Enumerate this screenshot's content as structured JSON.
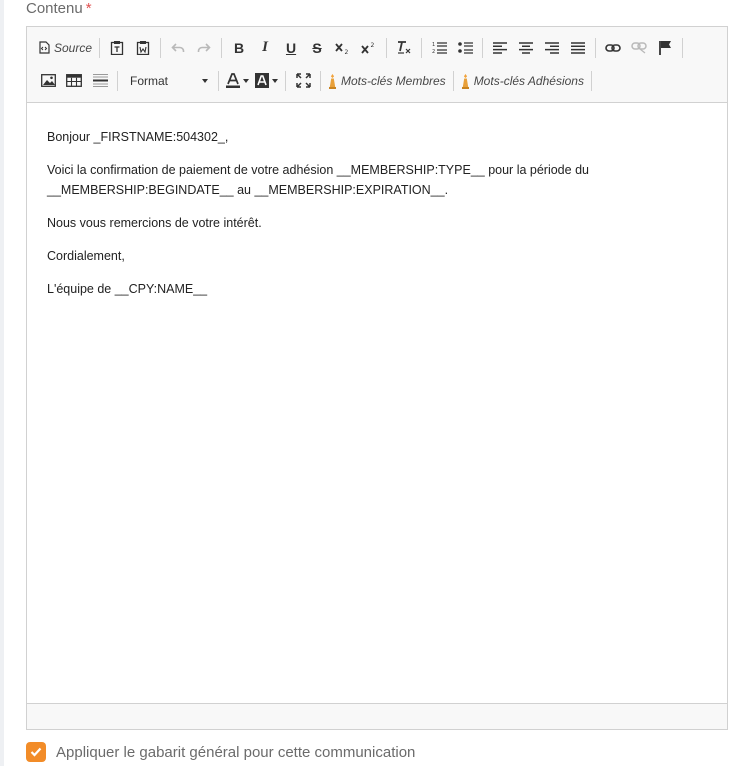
{
  "field": {
    "label": "Contenu",
    "required_mark": "*"
  },
  "toolbar": {
    "source_label": "Source",
    "format_label": "Format",
    "keywords_members_label": "Mots-clés Membres",
    "keywords_memberships_label": "Mots-clés Adhésions"
  },
  "content": {
    "paragraphs": [
      "Bonjour _FIRSTNAME:504302_,",
      "Voici la confirmation de paiement de votre adhésion __MEMBERSHIP:TYPE__ pour la période du __MEMBERSHIP:BEGINDATE__ au __MEMBERSHIP:EXPIRATION__.",
      "Nous vous remercions de votre intérêt.",
      "Cordialement,",
      "L'équipe de __CPY:NAME__"
    ]
  },
  "options": {
    "apply_template_label": "Appliquer le gabarit général pour cette communication",
    "apply_template_checked": true
  },
  "colors": {
    "accent": "#f28c28",
    "required": "#e05050"
  }
}
